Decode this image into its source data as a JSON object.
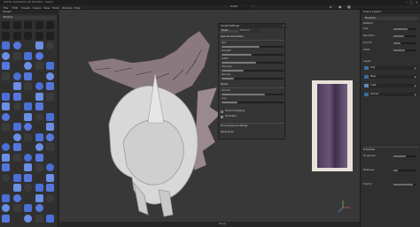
{
  "app": {
    "title": "Adobe Substance 3D Modeler - Demo",
    "menus": [
      "File",
      "Edit",
      "Create",
      "Scene",
      "View",
      "Tools",
      "Window",
      "Help"
    ]
  },
  "toolbar": {
    "tool_dropdown": "Sculpt"
  },
  "left_panel": {
    "header": "Sculpt",
    "brushes_label": "Brushes"
  },
  "settings_panel": {
    "title": "Sculpt Settings",
    "tabs": [
      "Brush",
      "Pressure"
    ],
    "section_general": "General Parameters",
    "rows": [
      {
        "label": "Size",
        "value": 0.62
      },
      {
        "label": "Strength",
        "value": 0.48
      },
      {
        "label": "Falloff",
        "value": 0.55
      },
      {
        "label": "Hardness",
        "value": 0.35
      },
      {
        "label": "Spacing",
        "value": 0.2
      }
    ],
    "section_stroke": "Stroke",
    "stroke_rows": [
      {
        "label": "Smooth",
        "value": 0.7
      },
      {
        "label": "Lazy",
        "value": 0.25
      }
    ],
    "toggle_1": "Surface Snapping",
    "toggle_2": "Symmetry",
    "footer_1": "Show advanced settings",
    "footer_2": "Reset brush"
  },
  "right_panel": {
    "header": "Scene Layers",
    "section_title": "Mountain",
    "section_material": "Material",
    "section_layers": "Layers",
    "props": [
      {
        "label": "Size",
        "value": 0.6
      },
      {
        "label": "Resolution",
        "value": 0.45
      },
      {
        "label": "Smooth",
        "value": 0.3
      },
      {
        "label": "Offset",
        "value": 0.5
      }
    ],
    "layer_items": [
      {
        "label": "Clay",
        "color": "#3a6ea5"
      },
      {
        "label": "Base",
        "color": "#3a6ea5"
      },
      {
        "label": "Crest",
        "color": "#5a8fc0"
      },
      {
        "label": "Helmet",
        "color": "#3a6ea5"
      }
    ],
    "lower_section": "Properties",
    "lower_props": [
      {
        "label": "Roughness",
        "value": 0.55
      },
      {
        "label": "Metalness",
        "value": 0.2
      },
      {
        "label": "Opacity",
        "value": 0.85
      }
    ]
  },
  "status": {
    "text": "Ready"
  },
  "colors": {
    "brush_blue": "#4a6fd6",
    "accent": "#5b8fd6",
    "model_base": "#d9d9d9",
    "reference_purple": "#5e4a6e"
  }
}
